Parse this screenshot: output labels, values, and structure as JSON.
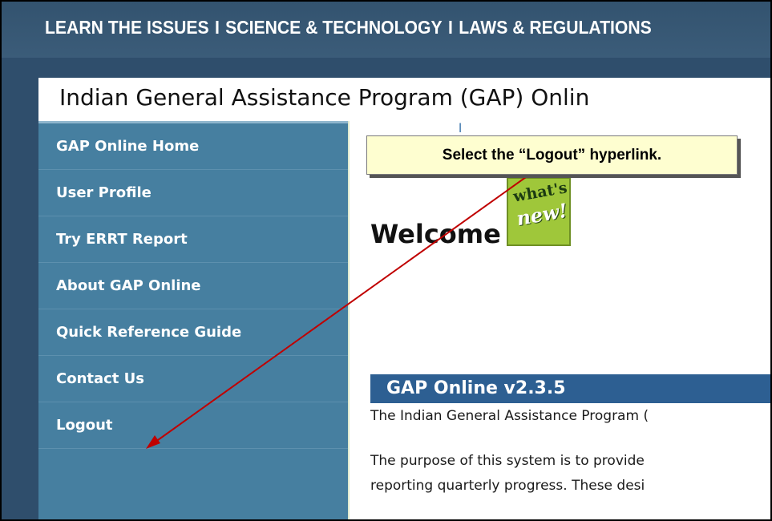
{
  "topnav": {
    "items": [
      "LEARN THE ISSUES",
      "SCIENCE & TECHNOLOGY",
      "LAWS & REGULATIONS"
    ],
    "separator": "I"
  },
  "page": {
    "title": "Indian General Assistance Program (GAP) Onlin"
  },
  "sidebar": {
    "items": [
      {
        "label": "GAP Online Home"
      },
      {
        "label": "User Profile"
      },
      {
        "label": "Try ERRT Report"
      },
      {
        "label": "About GAP Online"
      },
      {
        "label": "Quick Reference Guide"
      },
      {
        "label": "Contact Us"
      },
      {
        "label": "Logout"
      }
    ]
  },
  "content": {
    "link_fragment": "l",
    "welcome": "Welcome aieo",
    "whats_new_line1": "what's",
    "whats_new_line2": "new!",
    "version": "GAP Online v2.3.5",
    "intro_line": "The Indian General Assistance Program (",
    "purpose_line1": "The purpose of this system is to provide",
    "purpose_line2": "reporting quarterly progress. These desi"
  },
  "tutorial": {
    "callout_text": "Select the “Logout” hyperlink.",
    "arrow_color": "#c00000",
    "callout_bg": "#fefed0"
  },
  "colors": {
    "nav_bg": "#33536f",
    "sidebar_bg": "#467fa0",
    "version_bar_bg": "#2d5f92",
    "whats_new_bg": "#9fc73a"
  }
}
